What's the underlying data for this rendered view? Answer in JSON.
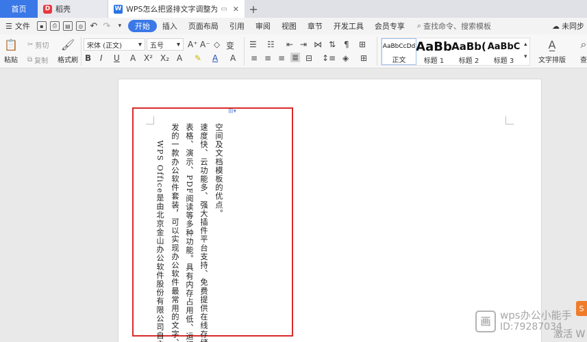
{
  "tabs": {
    "home": "首页",
    "daoke": "稻壳",
    "document": "WPS怎么把竖排文字调整为横排",
    "new_tab": "+"
  },
  "menu": {
    "file": "文件",
    "items": [
      "开始",
      "插入",
      "页面布局",
      "引用",
      "审阅",
      "视图",
      "章节",
      "开发工具",
      "会员专享"
    ],
    "active": "开始",
    "search": "查找命令、搜索模板",
    "right_label": "未同步"
  },
  "ribbon": {
    "paste": "粘贴",
    "cut": "剪切",
    "copy": "复制",
    "format_painter": "格式刷",
    "font_name": "宋体 (正文)",
    "font_size": "五号",
    "styles": [
      {
        "preview": "AaBbCcDd",
        "label": "正文"
      },
      {
        "preview": "AaBb",
        "label": "标题 1"
      },
      {
        "preview": "AaBb(",
        "label": "标题 2"
      },
      {
        "preview": "AaBbC",
        "label": "标题 3"
      }
    ],
    "text_layout": "文字排版",
    "find_label": "查"
  },
  "document": {
    "columns": [
      "空间及文档模板的优点。",
      "速度快、云功能多、强大插件平台支持、免费提供在线存储",
      "表格、演示、PDF阅读等多种功能。具有内存占用低、运行",
      "发的一款办公软件套装，可以实现办公软件最常用的文字、",
      "WPS Office是由北京金山办公软件股份有限公司自主研"
    ]
  },
  "watermark": {
    "name": "wps办公小能手",
    "id": "ID:79287034",
    "activate": "激活 W"
  },
  "colors": {
    "accent": "#3b78e7",
    "frame_red": "#d92a2a"
  }
}
